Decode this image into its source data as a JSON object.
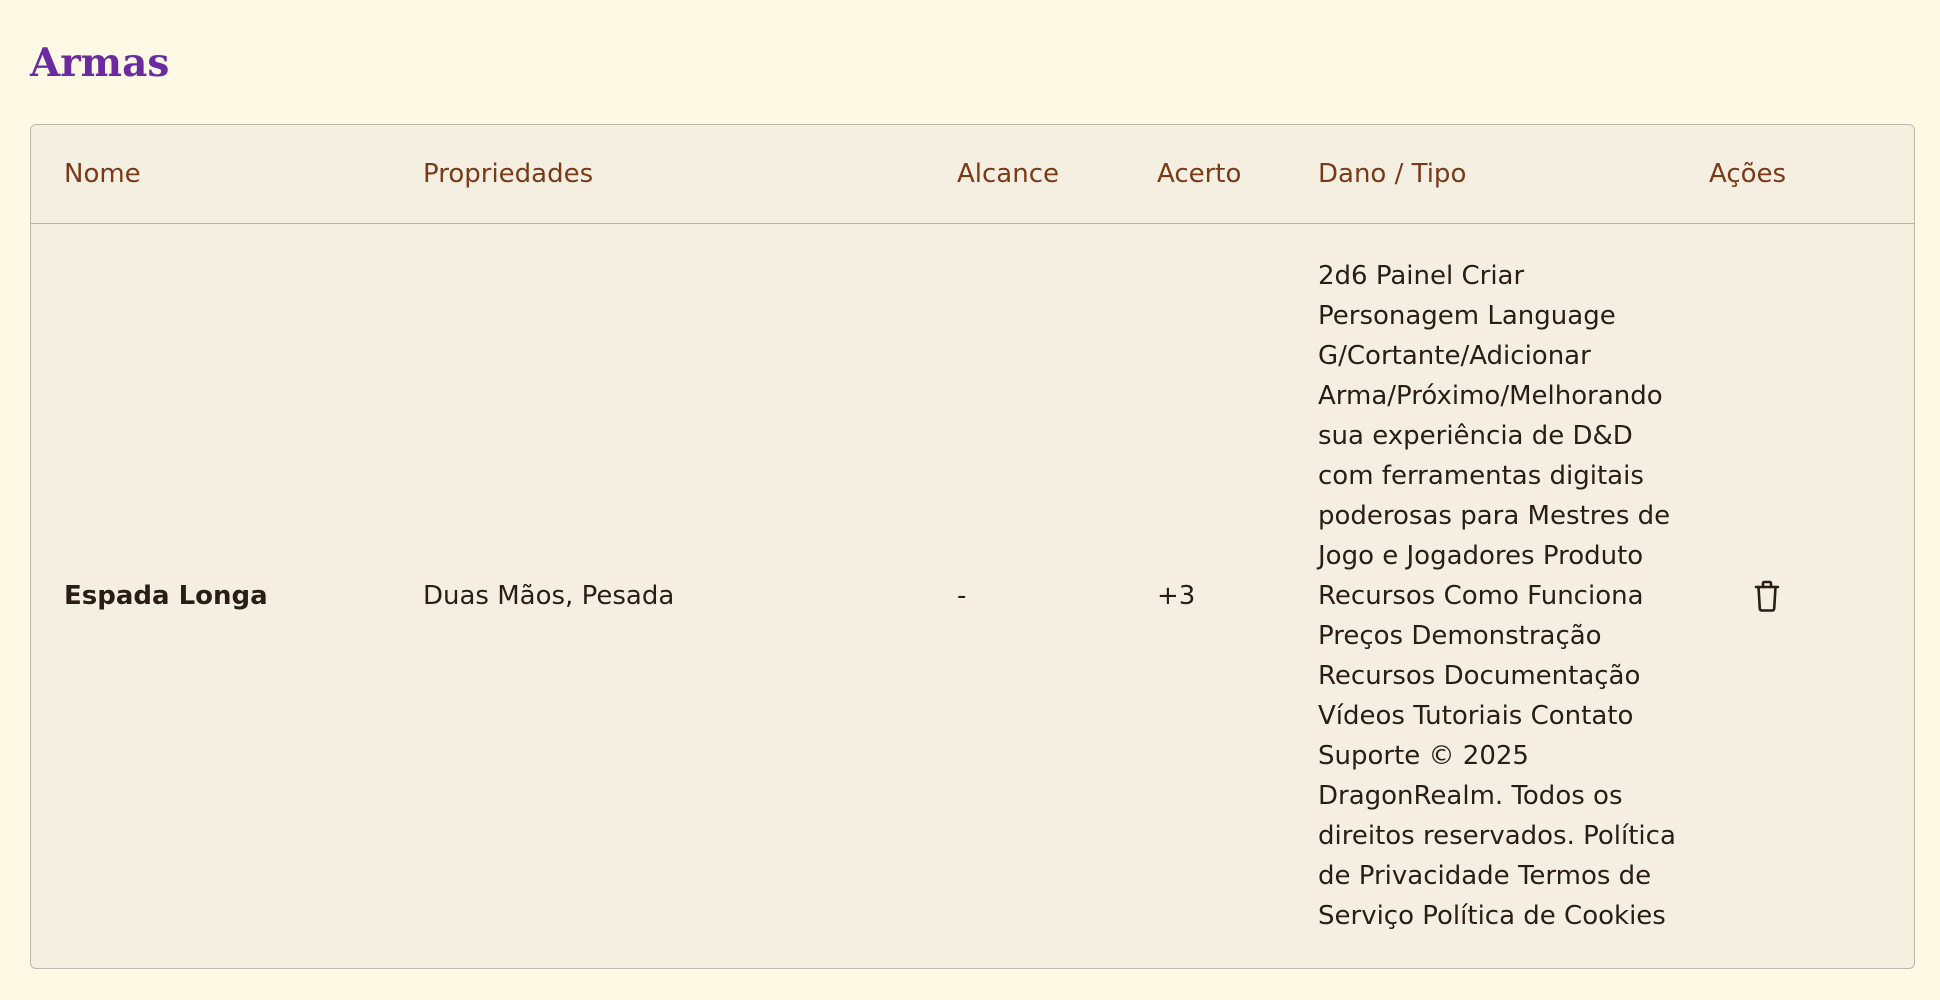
{
  "section": {
    "title": "Armas"
  },
  "table": {
    "headers": {
      "name": "Nome",
      "properties": "Propriedades",
      "range": "Alcance",
      "hit": "Acerto",
      "damage": "Dano / Tipo",
      "actions": "Ações"
    },
    "rows": [
      {
        "name": "Espada Longa",
        "properties": "Duas Mãos, Pesada",
        "range": "-",
        "hit": "+3",
        "damage": "2d6 Painel Criar Personagem Language G/Cortante/Adicionar Arma/Próximo/Melhorando sua experiência de D&D com ferramentas digitais poderosas para Mestres de Jogo e Jogadores Produto Recursos Como Funciona Preços Demonstração Recursos Documentação Vídeos Tutoriais Contato Suporte © 2025 DragonRealm. Todos os direitos reservados. Política de Privacidade Termos de Serviço Política de Cookies",
        "action_icon": "trash-icon"
      }
    ]
  },
  "colors": {
    "page_background": "#fef9e5",
    "title": "#6b2aa0",
    "header_text": "#7a3a18",
    "card_background": "#f5efe2"
  }
}
